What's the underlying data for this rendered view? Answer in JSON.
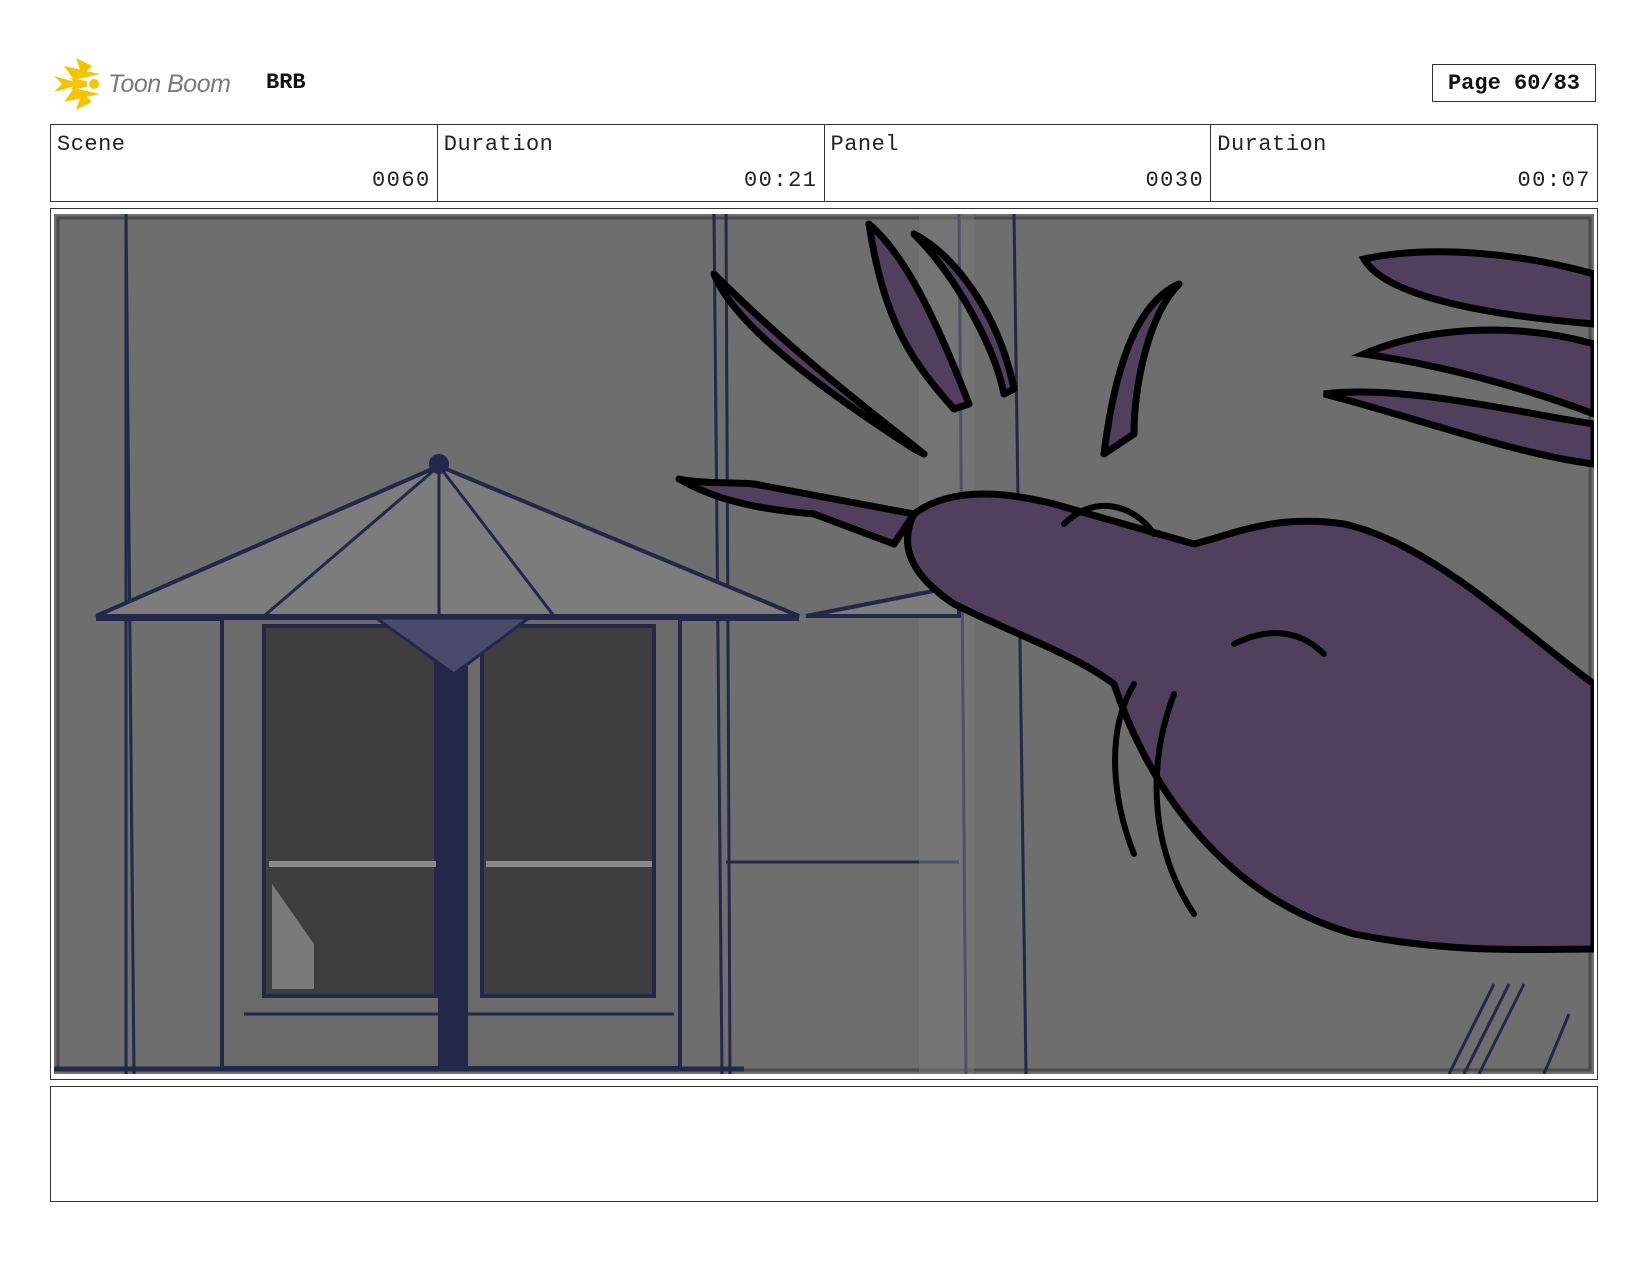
{
  "header": {
    "logo_text": "Toon Boom",
    "project": "BRB",
    "page": "Page 60/83"
  },
  "info": {
    "scene_label": "Scene",
    "scene_value": "0060",
    "scene_duration_label": "Duration",
    "scene_duration_value": "00:21",
    "panel_label": "Panel",
    "panel_value": "0030",
    "panel_duration_label": "Duration",
    "panel_duration_value": "00:07"
  },
  "colors": {
    "accent": "#f5c400",
    "background": "#6e6e6e",
    "line": "#24264a",
    "hand": "#50405e"
  },
  "icons": {
    "logo": "toon-boom-sunburst-icon"
  },
  "notes": ""
}
